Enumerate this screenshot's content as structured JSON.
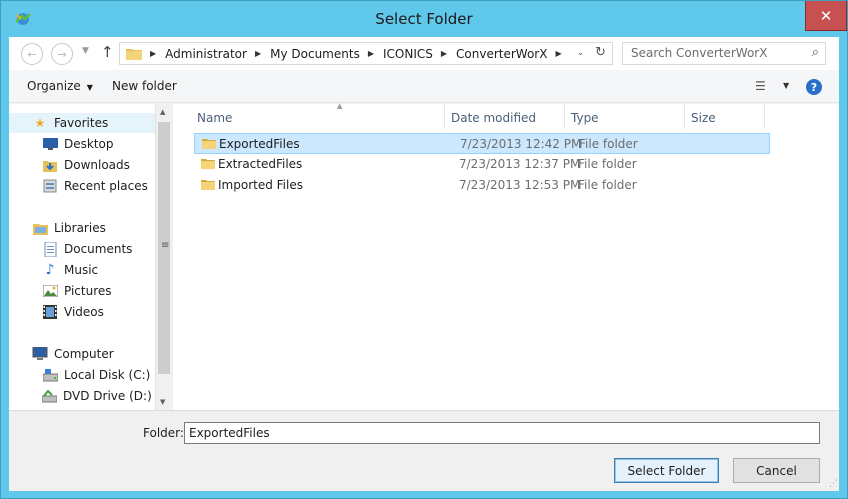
{
  "window": {
    "title": "Select Folder",
    "close_glyph": "✕",
    "accent": "#60c8ea"
  },
  "address": {
    "crumbs": [
      "Administrator",
      "My Documents",
      "ICONICS",
      "ConverterWorX"
    ],
    "search_placeholder": "Search ConverterWorX"
  },
  "toolbar": {
    "organize_label": "Organize",
    "new_folder_label": "New folder",
    "help_glyph": "?"
  },
  "nav": {
    "favorites": {
      "label": "Favorites",
      "icon": "star-icon"
    },
    "favorites_items": [
      {
        "label": "Desktop",
        "icon": "desktop-icon"
      },
      {
        "label": "Downloads",
        "icon": "downloads-icon"
      },
      {
        "label": "Recent places",
        "icon": "recent-places-icon"
      }
    ],
    "libraries": {
      "label": "Libraries",
      "icon": "library-icon"
    },
    "libraries_items": [
      {
        "label": "Documents",
        "icon": "documents-icon"
      },
      {
        "label": "Music",
        "icon": "music-icon"
      },
      {
        "label": "Pictures",
        "icon": "pictures-icon"
      },
      {
        "label": "Videos",
        "icon": "videos-icon"
      }
    ],
    "computer": {
      "label": "Computer",
      "icon": "computer-icon"
    },
    "computer_items": [
      {
        "label": "Local Disk (C:)",
        "icon": "disk-icon"
      },
      {
        "label": "DVD Drive (D:) HI",
        "icon": "dvd-icon"
      }
    ]
  },
  "columns": {
    "name": "Name",
    "date": "Date modified",
    "type": "Type",
    "size": "Size"
  },
  "files": [
    {
      "name": "ExportedFiles",
      "date": "7/23/2013 12:42 PM",
      "type": "File folder",
      "selected": true
    },
    {
      "name": "ExtractedFiles",
      "date": "7/23/2013 12:37 PM",
      "type": "File folder",
      "selected": false
    },
    {
      "name": "Imported Files",
      "date": "7/23/2013 12:53 PM",
      "type": "File folder",
      "selected": false
    }
  ],
  "bottom": {
    "folder_label": "Folder:",
    "folder_value": "ExportedFiles",
    "select_label": "Select Folder",
    "cancel_label": "Cancel"
  }
}
